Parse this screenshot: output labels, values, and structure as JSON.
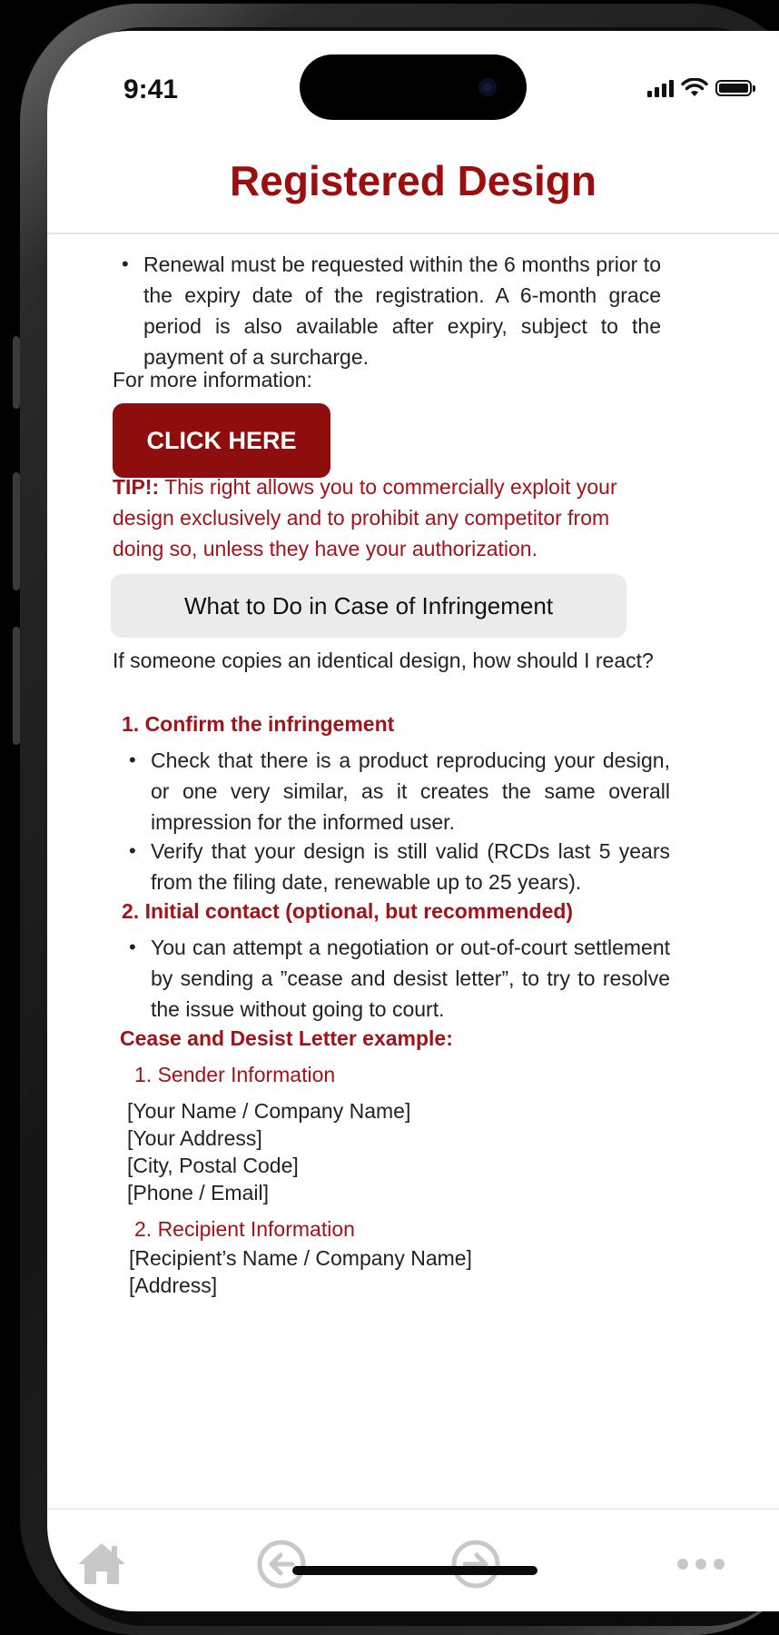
{
  "status_bar": {
    "time": "9:41"
  },
  "header": {
    "title": "Registered Design"
  },
  "content": {
    "renewal_bullet": "Renewal must be requested within the 6 months prior to the expiry date of the registration. A 6-month grace period is also available after expiry, subject to the payment of a surcharge.",
    "more_info_label": "For more information:",
    "click_button_label": "CLICK HERE",
    "tip_label": "TIP!:",
    "tip_text": "This right allows you to commercially exploit your design exclusively and to prohibit any competitor from doing so, unless they have your authorization.",
    "section_title": "What to Do in Case of Infringement",
    "intro": "If someone copies an identical design, how should I react?",
    "steps": [
      {
        "title": "1. Confirm the infringement",
        "bullets": [
          "Check that there is a product reproducing your design, or one very similar, as it creates the same overall impression for the informed user.",
          "Verify that your design is still valid (RCDs last 5 years from the filing date, renewable up to 25 years)."
        ]
      },
      {
        "title": "2. Initial contact (optional, but recommended)",
        "bullets": [
          "You can attempt a negotiation or out-of-court settlement by sending a ”cease and desist letter”, to try to resolve the issue without going to court."
        ]
      }
    ],
    "letter": {
      "title": "Cease and Desist Letter example:",
      "sender_heading": "1. Sender Information",
      "sender_lines": [
        "[Your Name / Company Name]",
        "[Your Address]",
        "[City, Postal Code]",
        "[Phone / Email]"
      ],
      "recipient_heading": "2. Recipient Information",
      "recipient_lines": [
        "[Recipient’s Name / Company Name]",
        "[Address]"
      ]
    }
  },
  "nav": {
    "icons": [
      "home-icon",
      "back-arrow-icon",
      "forward-arrow-icon",
      "more-icon"
    ],
    "icon_color": "#c8c8c8"
  },
  "colors": {
    "accent": "#9b0f0f",
    "button": "#8e0d0d",
    "section_bg": "#ebebeb"
  }
}
